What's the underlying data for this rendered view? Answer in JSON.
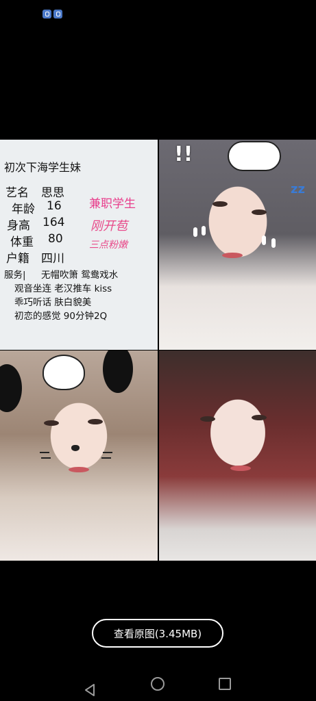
{
  "card": {
    "title": "初次下海学生妹",
    "stage_name_label": "艺名",
    "stage_name": "思思",
    "age_label": "年龄",
    "age": "16",
    "height_label": "身高",
    "height": "164",
    "weight_label": "体重",
    "weight": "80",
    "hometown_label": "户籍",
    "hometown": "四川",
    "tag1": "兼职学生",
    "tag2": "刚开苞",
    "tag3": "三点粉嫩",
    "services_label": "服务|",
    "services_line1": "无帽吹箫 鸳鸯戏水",
    "services_line2": "观音坐连 老汉推车 kiss",
    "services_line3": "乖巧听话 肤白貌美",
    "services_line4": "初恋的感觉 90分钟2Q"
  },
  "viewer": {
    "view_original_label": "查看原图(3.45MB)"
  },
  "icons": {
    "status": "app-status-icon",
    "back": "back-triangle-icon",
    "home": "home-circle-icon",
    "recent": "recent-square-icon"
  }
}
